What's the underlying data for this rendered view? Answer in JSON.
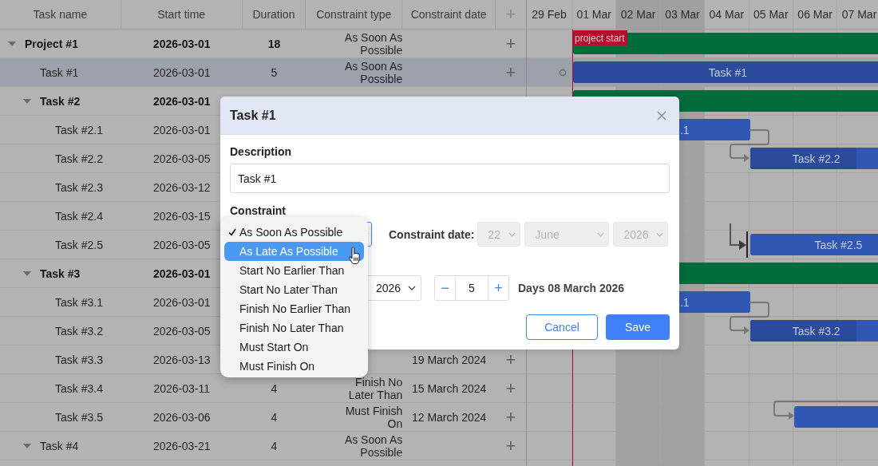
{
  "grid": {
    "columns": [
      {
        "label": "Task name"
      },
      {
        "label": "Start time"
      },
      {
        "label": "Duration"
      },
      {
        "label": "Constraint type"
      },
      {
        "label": "Constraint date"
      },
      {
        "label": "+"
      }
    ],
    "tasks": [
      {
        "name": "Project #1",
        "start": "2026-03-01",
        "duration": "18",
        "constraint": "As Soon As Possible",
        "add": "+",
        "expanded": true,
        "selected": false,
        "bar": {
          "kind": "summary"
        },
        "children": [
          {
            "name": "Task #1",
            "start": "2026-03-01",
            "duration": "5",
            "constraint": "As Soon As Possible",
            "add": "+",
            "selected": true,
            "bar": {
              "kind": "task",
              "label": "Task #1"
            }
          },
          {
            "name": "Task #2",
            "start": "2026-03-01",
            "expanded": true,
            "selected": false,
            "bar": {
              "kind": "summary"
            },
            "children": [
              {
                "name": "Task #2.1",
                "start": "2026-03-01",
                "selected": false,
                "bar": {
                  "kind": "task",
                  "label": ".1"
                }
              },
              {
                "name": "Task #2.2",
                "start": "2026-03-05",
                "selected": false,
                "bar": {
                  "kind": "task",
                  "label": "Task #2.2",
                  "level": 0.8
                }
              },
              {
                "name": "Task #2.3",
                "start": "2026-03-12",
                "selected": false
              },
              {
                "name": "Task #2.4",
                "start": "2026-03-15",
                "selected": false
              },
              {
                "name": "Task #2.5",
                "start": "2026-03-05",
                "selected": false,
                "bar": {
                  "kind": "task",
                  "label": "Task #2.5"
                }
              }
            ]
          },
          {
            "name": "Task #3",
            "start": "2026-03-01",
            "expanded": true,
            "selected": false,
            "bar": {
              "kind": "summary"
            },
            "children": [
              {
                "name": "Task #3.1",
                "start": "2026-03-01",
                "selected": false,
                "bar": {
                  "kind": "task",
                  "label": ".1"
                }
              },
              {
                "name": "Task #3.2",
                "start": "2026-03-05",
                "selected": false,
                "bar": {
                  "kind": "task",
                  "label": "Task #3.2",
                  "level": 0.8
                }
              },
              {
                "name": "Task #3.3",
                "start": "2026-03-13",
                "constraint_date": "19 March 2024",
                "add": "+",
                "selected": false
              },
              {
                "name": "Task #3.4",
                "start": "2026-03-11",
                "duration": "4",
                "constraint": "Finish No Later Than",
                "constraint_date": "15 March 2024",
                "add": "+",
                "selected": false
              },
              {
                "name": "Task #3.5",
                "start": "2026-03-06",
                "duration": "4",
                "constraint": "Must Finish On",
                "constraint_date": "12 March 2024",
                "add": "+",
                "selected": false,
                "bar": {
                  "kind": "task"
                }
              }
            ]
          },
          {
            "name": "Task #4",
            "start": "2026-03-21",
            "duration": "4",
            "constraint": "As Soon As Possible",
            "add": "+",
            "expanded": true,
            "selected": false
          }
        ]
      }
    ]
  },
  "timeline": {
    "days": [
      {
        "label": "29 Feb",
        "weekend": false
      },
      {
        "label": "01 Mar",
        "weekend": false
      },
      {
        "label": "02 Mar",
        "weekend": true
      },
      {
        "label": "03 Mar",
        "weekend": true
      },
      {
        "label": "04 Mar",
        "weekend": false
      },
      {
        "label": "05 Mar",
        "weekend": false
      },
      {
        "label": "06 Mar",
        "weekend": false
      },
      {
        "label": "07 Mar",
        "weekend": false
      }
    ],
    "marker": {
      "label": "project start"
    }
  },
  "dialog": {
    "title": "Task #1",
    "description_label": "Description",
    "description_value": "Task #1",
    "constraint_label": "Constraint",
    "constraint_date_label": "Constraint date:",
    "date_selects": [
      {
        "value": "22",
        "disabled": true
      },
      {
        "value": "June",
        "disabled": true
      },
      {
        "value": "2026",
        "disabled": true
      }
    ],
    "year_select": "2026",
    "stepper": {
      "minus": "−",
      "value": "5",
      "plus": "+"
    },
    "days_text": "Days 08 March 2026",
    "buttons": [
      {
        "label": "Cancel",
        "kind": "secondary"
      },
      {
        "label": "Save",
        "kind": "primary"
      }
    ]
  },
  "dropdown": {
    "items": [
      {
        "label": "As Soon As Possible",
        "checked": true,
        "selected": false
      },
      {
        "label": "As Late As Possible",
        "checked": false,
        "selected": true
      },
      {
        "label": "Start No Earlier Than",
        "checked": false,
        "selected": false
      },
      {
        "label": "Start No Later Than",
        "checked": false,
        "selected": false
      },
      {
        "label": "Finish No Earlier Than",
        "checked": false,
        "selected": false
      },
      {
        "label": "Finish No Later Than",
        "checked": false,
        "selected": false
      },
      {
        "label": "Must Start On",
        "checked": false,
        "selected": false
      },
      {
        "label": "Must Finish On",
        "checked": false,
        "selected": false
      }
    ]
  }
}
